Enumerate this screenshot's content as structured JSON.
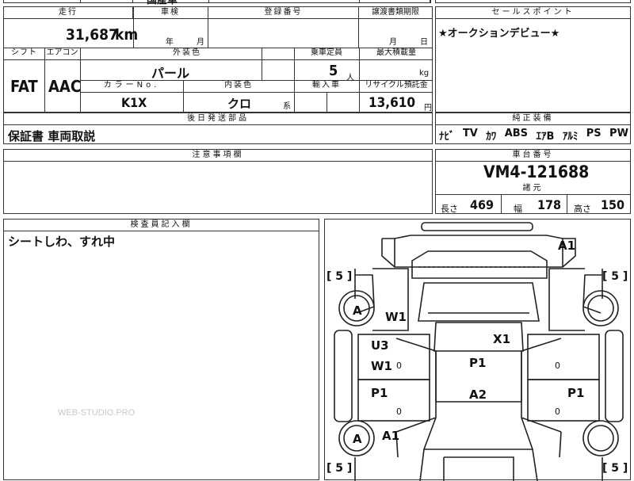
{
  "top_strip": {
    "partial_text": "国産車"
  },
  "main": {
    "mileage_label": "走行",
    "mileage_value": "31,687",
    "mileage_unit": "km",
    "inspection_label": "車検",
    "inspection_year_unit": "年",
    "inspection_month_unit": "月",
    "registration_label": "登録番号",
    "transfer_label": "譲渡書類期限",
    "transfer_month_unit": "月",
    "transfer_day_unit": "日",
    "shift_label": "シフト",
    "shift_value": "FAT",
    "ac_label": "エアコン",
    "ac_value": "AAC",
    "exterior_label": "外装色",
    "exterior_value": "パール",
    "seats_label": "乗車定員",
    "seats_value": "5",
    "seats_unit": "人",
    "load_label": "最大積載量",
    "load_unit": "kg",
    "color_no_label": "カラーNo.",
    "color_no_value": "K1X",
    "interior_label": "内装色",
    "interior_value": "クロ",
    "interior_suffix": "系",
    "import_label": "輸入車",
    "recycle_label": "リサイクル預託金",
    "recycle_value": "13,610",
    "recycle_unit": "円"
  },
  "sales_point": {
    "label": "セールスポイント",
    "text": "★オークションデビュー★"
  },
  "deferred_parts": {
    "label": "後日発送部品",
    "text": "保証書 車両取説"
  },
  "equipment": {
    "label": "純正装備",
    "items": [
      "ﾅﾋﾞ",
      "TV",
      "ｶﾜ",
      "ABS",
      "ｴｱB",
      "ｱﾙﾐ",
      "PS",
      "PW"
    ]
  },
  "notes": {
    "label": "注意事項欄"
  },
  "chassis": {
    "label": "車台番号",
    "value": "VM4-121688",
    "specs_label": "諸元",
    "length_label": "長さ",
    "length_value": "469",
    "width_label": "幅",
    "width_value": "178",
    "height_label": "高さ",
    "height_value": "150"
  },
  "inspector": {
    "label": "検査員記入欄",
    "text": "シートしわ、すれ中"
  },
  "watermark": "WEB-STUDIO.PRO",
  "diagram": {
    "marks": {
      "front_right": "A1",
      "tire_fl": "[ 5 ]",
      "tire_fr": "[ 5 ]",
      "tire_rl": "[ 5 ]",
      "tire_rr": "[ 5 ]",
      "wheel_fl": "A",
      "fender_l": "W1",
      "door_fl_1": "U3",
      "door_fl_2": "W1",
      "roof_front": "X1",
      "roof": "P1",
      "door_rl": "P1",
      "door_rr": "P1",
      "rear_roof": "A2",
      "wheel_rl": "A",
      "rear_fender_l": "A1",
      "zero": "0"
    }
  }
}
